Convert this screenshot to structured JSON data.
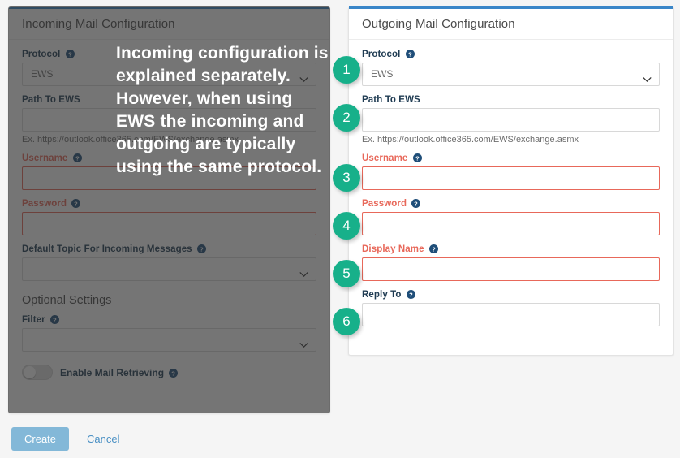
{
  "colors": {
    "page_background": "#f5f5f5",
    "card_top_accent": "#3a86c8",
    "badge": "#17b08a",
    "required_label": "#e8685a",
    "label": "#1f3b52",
    "create_button": "#83b8d8",
    "cancel_link": "#4a90c4",
    "dim_overlay": "rgba(45,45,45,0.66)"
  },
  "annotation": {
    "text": "Incoming configuration is explained separately. However, when using EWS the incoming and outgoing are typically using the same protocol."
  },
  "incoming": {
    "title": "Incoming Mail Configuration",
    "fields": {
      "protocol": {
        "label": "Protocol",
        "value": "EWS",
        "options": [
          "EWS"
        ],
        "help_icon": "help-circle-icon",
        "required": false
      },
      "path_to_ews": {
        "label": "Path To EWS",
        "value": "",
        "hint": "Ex. https://outlook.office365.com/EWS/exchange.asmx",
        "required": false
      },
      "username": {
        "label": "Username",
        "value": "",
        "help_icon": "help-circle-icon",
        "required": true
      },
      "password": {
        "label": "Password",
        "value": "",
        "help_icon": "help-circle-icon",
        "required": true
      },
      "default_topic": {
        "label": "Default Topic For Incoming Messages",
        "value": "",
        "options": [],
        "help_icon": "help-circle-icon",
        "required": false
      },
      "filter": {
        "label": "Filter",
        "value": "",
        "options": [],
        "help_icon": "help-circle-icon",
        "required": false
      }
    },
    "optional_settings_heading": "Optional Settings",
    "enable_mail_retrieving": {
      "label": "Enable Mail Retrieving",
      "state": "off",
      "help_icon": "help-circle-icon"
    }
  },
  "outgoing": {
    "title": "Outgoing Mail Configuration",
    "fields": {
      "protocol": {
        "label": "Protocol",
        "value": "EWS",
        "options": [
          "EWS"
        ],
        "help_icon": "help-circle-icon",
        "required": false,
        "badge": "1"
      },
      "path_to_ews": {
        "label": "Path To EWS",
        "value": "",
        "hint": "Ex. https://outlook.office365.com/EWS/exchange.asmx",
        "required": false,
        "badge": "2"
      },
      "username": {
        "label": "Username",
        "value": "",
        "help_icon": "help-circle-icon",
        "required": true,
        "badge": "3"
      },
      "password": {
        "label": "Password",
        "value": "",
        "help_icon": "help-circle-icon",
        "required": true,
        "badge": "4"
      },
      "display_name": {
        "label": "Display Name",
        "value": "",
        "help_icon": "help-circle-icon",
        "required": true,
        "badge": "5"
      },
      "reply_to": {
        "label": "Reply To",
        "value": "",
        "help_icon": "help-circle-icon",
        "required": false,
        "badge": "6"
      }
    }
  },
  "footer": {
    "create_label": "Create",
    "cancel_label": "Cancel"
  }
}
